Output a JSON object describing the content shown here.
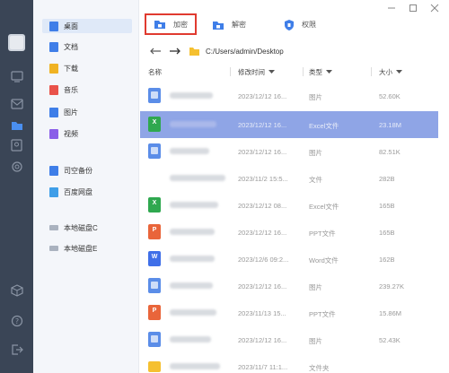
{
  "window": {
    "controls": [
      "minimize-icon",
      "maximize-icon",
      "close-icon"
    ]
  },
  "rail": {
    "icons": [
      "avatar",
      "monitor-icon",
      "mail-icon",
      "folder-icon",
      "contact-icon",
      "gear-icon",
      "cube-icon",
      "help-icon",
      "logout-icon"
    ]
  },
  "sidebar": {
    "items": [
      {
        "label": "桌面",
        "icon": "desktop-icon",
        "color": "#3f7ee8",
        "active": true
      },
      {
        "label": "文档",
        "icon": "document-icon",
        "color": "#3f7ee8"
      },
      {
        "label": "下载",
        "icon": "download-icon",
        "color": "#f0b323"
      },
      {
        "label": "音乐",
        "icon": "music-icon",
        "color": "#e9524a"
      },
      {
        "label": "图片",
        "icon": "image-icon",
        "color": "#3f7ee8"
      },
      {
        "label": "视频",
        "icon": "video-icon",
        "color": "#8a5ee8"
      },
      {
        "label": "司空备份",
        "icon": "backup-icon",
        "color": "#3f7ee8"
      },
      {
        "label": "百度网盘",
        "icon": "cloud-icon",
        "color": "#3f9ee8"
      },
      {
        "label": "本地磁盘C",
        "icon": "disk-icon",
        "color": "#aab2bf"
      },
      {
        "label": "本地磁盘E",
        "icon": "disk-icon",
        "color": "#aab2bf"
      }
    ]
  },
  "toolbar": {
    "add_label": "加密",
    "unzip_label": "解密",
    "perm_label": "权限",
    "highlight_color": "#e03a2f"
  },
  "path": {
    "text": "C:/Users/admin/Desktop"
  },
  "columns": {
    "name": "名称",
    "modified": "修改时间",
    "type": "类型",
    "size": "大小"
  },
  "rows": [
    {
      "modified": "2023/12/12 16...",
      "type": "图片",
      "size": "52.60K",
      "icon": "image-file-icon",
      "color": "#5b8de8"
    },
    {
      "modified": "2023/12/12 16...",
      "type": "Excel文件",
      "size": "23.18M",
      "icon": "excel-file-icon",
      "color": "#2fa84f",
      "selected": true
    },
    {
      "modified": "2023/12/12 16...",
      "type": "图片",
      "size": "82.51K",
      "icon": "image-file-icon",
      "color": "#5b8de8"
    },
    {
      "modified": "2023/11/2 15:5...",
      "type": "文件",
      "size": "282B",
      "icon": "file-icon",
      "color": "#ffffff"
    },
    {
      "modified": "2023/12/12 08...",
      "type": "Excel文件",
      "size": "165B",
      "icon": "excel-file-icon",
      "color": "#2fa84f"
    },
    {
      "modified": "2023/12/12 16...",
      "type": "PPT文件",
      "size": "165B",
      "icon": "ppt-file-icon",
      "color": "#e9653a"
    },
    {
      "modified": "2023/12/6 09:2...",
      "type": "Word文件",
      "size": "162B",
      "icon": "word-file-icon",
      "color": "#3f6fe8"
    },
    {
      "modified": "2023/12/12 16...",
      "type": "图片",
      "size": "239.27K",
      "icon": "image-file-icon",
      "color": "#5b8de8"
    },
    {
      "modified": "2023/11/13 15...",
      "type": "PPT文件",
      "size": "15.86M",
      "icon": "ppt-file-icon",
      "color": "#e9653a"
    },
    {
      "modified": "2023/12/12 16...",
      "type": "图片",
      "size": "52.43K",
      "icon": "image-file-icon",
      "color": "#5b8de8"
    },
    {
      "modified": "2023/11/7 11:1...",
      "type": "文件夹",
      "size": "",
      "icon": "folder-file-icon",
      "color": "#f5c030"
    }
  ]
}
